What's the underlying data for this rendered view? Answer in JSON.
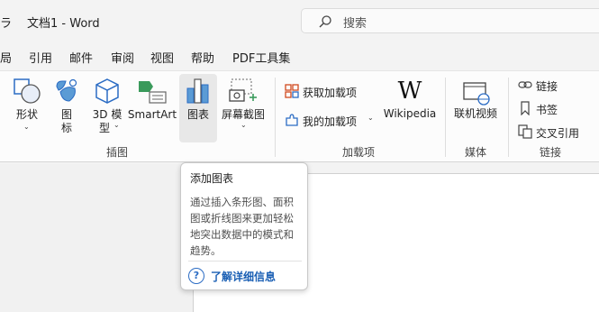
{
  "titlebar": {
    "left_glyph": "ラ",
    "doc_title": "文档1  -  Word",
    "search_placeholder": "搜索"
  },
  "menu": {
    "tabs": [
      "局",
      "引用",
      "邮件",
      "审阅",
      "视图",
      "帮助",
      "PDF工具集"
    ]
  },
  "ribbon": {
    "illustrations": {
      "shapes": "形状",
      "icons_line1": "图",
      "icons_line2": "标",
      "model3d_line1": "3D 模",
      "model3d_line2": "型",
      "smartart": "SmartArt",
      "chart": "图表",
      "screenshot": "屏幕截图",
      "group": "插图"
    },
    "addins": {
      "get": "获取加载项",
      "my": "我的加载项",
      "wikipedia": "Wikipedia",
      "wiki_logo": "W",
      "group": "加载项"
    },
    "media": {
      "online_video": "联机视频",
      "group": "媒体"
    },
    "links": {
      "link": "链接",
      "bookmark": "书签",
      "crossref": "交叉引用",
      "group": "链接"
    }
  },
  "tooltip": {
    "title": "添加图表",
    "description": "通过插入条形图、面积图或折线图来更加轻松地突出数据中的模式和趋势。",
    "help_icon": "?",
    "help_link": "了解详细信息"
  },
  "colors": {
    "accent_blue": "#2b6cc4",
    "chart_blue": "#5b9bd5",
    "smartart_green": "#3a9a5b",
    "addin_orange": "#d04a1f"
  }
}
